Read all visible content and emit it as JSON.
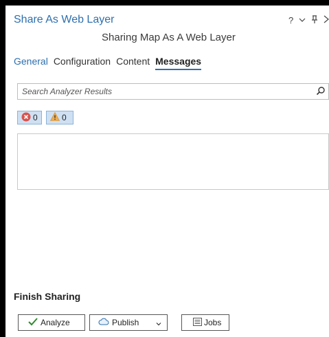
{
  "window": {
    "title": "Share As Web Layer",
    "help_label": "?",
    "subtitle": "Sharing Map As A Web Layer"
  },
  "tabs": [
    {
      "label": "General"
    },
    {
      "label": "Configuration"
    },
    {
      "label": "Content"
    },
    {
      "label": "Messages"
    }
  ],
  "search": {
    "placeholder": "Search Analyzer Results"
  },
  "filters": {
    "errors_count": "0",
    "warnings_count": "0"
  },
  "finish": {
    "heading": "Finish Sharing",
    "analyze_label": "Analyze",
    "publish_label": "Publish",
    "jobs_label": "Jobs"
  },
  "colors": {
    "accent": "#2d6fae",
    "error": "#d9534f",
    "warning": "#f0ad4e",
    "success": "#2e8b2e"
  }
}
